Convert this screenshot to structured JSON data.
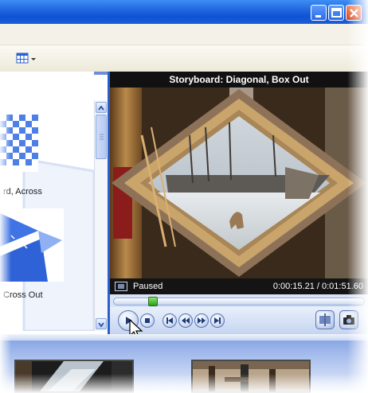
{
  "window": {
    "controls": [
      "minimize-icon",
      "maximize-icon",
      "close-icon"
    ]
  },
  "toolbar": {
    "view_icon": "grid-view-icon"
  },
  "transitions": {
    "items": [
      {
        "label": "rd, Across"
      },
      {
        "label": "Cross Out"
      }
    ]
  },
  "monitor": {
    "title": "Storyboard: Diagonal, Box Out",
    "status": "Paused",
    "time": "0:00:15.21 / 0:01:51.60",
    "seek_position_fraction": 0.14
  },
  "controls": {
    "buttons": [
      "play-icon",
      "stop-icon",
      "previous-frame-icon",
      "rewind-icon",
      "fast-forward-icon",
      "next-frame-icon",
      "split-clip-icon",
      "take-picture-icon"
    ]
  },
  "colors": {
    "titlebar": "#1a5ed8",
    "accent": "#2a5fcf",
    "monitor_bg": "#d9e3f6",
    "seek_knob": "#2c9c1a"
  }
}
